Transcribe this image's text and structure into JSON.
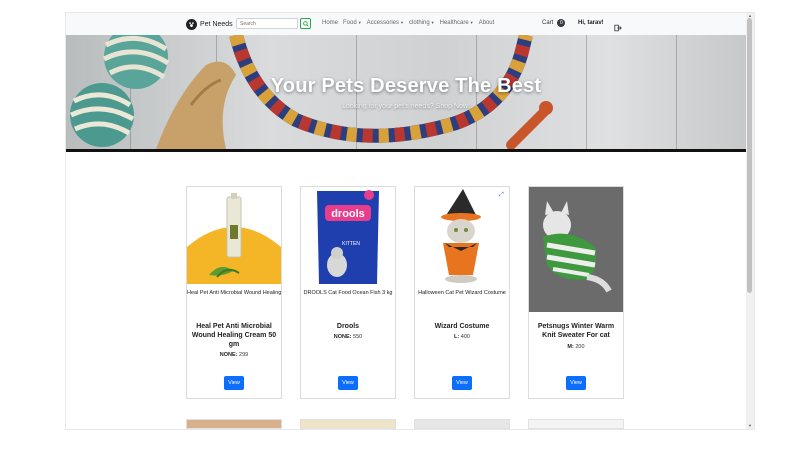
{
  "navbar": {
    "brand": "Pet Needs",
    "search_placeholder": "Search",
    "links": [
      {
        "label": "Home",
        "dropdown": false
      },
      {
        "label": "Food",
        "dropdown": true
      },
      {
        "label": "Accessories",
        "dropdown": true
      },
      {
        "label": "clothing",
        "dropdown": true
      },
      {
        "label": "Healthcare",
        "dropdown": true
      },
      {
        "label": "About",
        "dropdown": false
      }
    ],
    "cart_label": "Cart",
    "cart_count": "0",
    "greeting": "Hi, tarav!",
    "logout_icon": "logout-icon"
  },
  "hero": {
    "title": "Your Pets Deserve The Best",
    "subtitle": "Looking for your pet's needs? Shop Now!"
  },
  "products": [
    {
      "caption": "Heal Pet Anti Microbial Wound Healing Cream 50 gm",
      "title": "Heal Pet Anti Microbial Wound Healing Cream 50 gm",
      "size": "NONE:",
      "price": "299",
      "button": "View"
    },
    {
      "caption": "DROOLS Cat Food Ocean Fish 3 kg",
      "title": "Drools",
      "size": "NONE:",
      "price": "550",
      "button": "View"
    },
    {
      "caption": "Halloween Cat Pet Wizard Costume",
      "title": "Wizard Costume",
      "size": "L:",
      "price": "400",
      "button": "View"
    },
    {
      "caption": "",
      "title": "Petsnugs Winter Warm Knit Sweater For cat",
      "size": "M:",
      "price": "200",
      "button": "View"
    }
  ],
  "colors": {
    "accent": "#0d6efd",
    "navbar_bg": "#f8f9fa",
    "search_button_border": "#28a745"
  }
}
